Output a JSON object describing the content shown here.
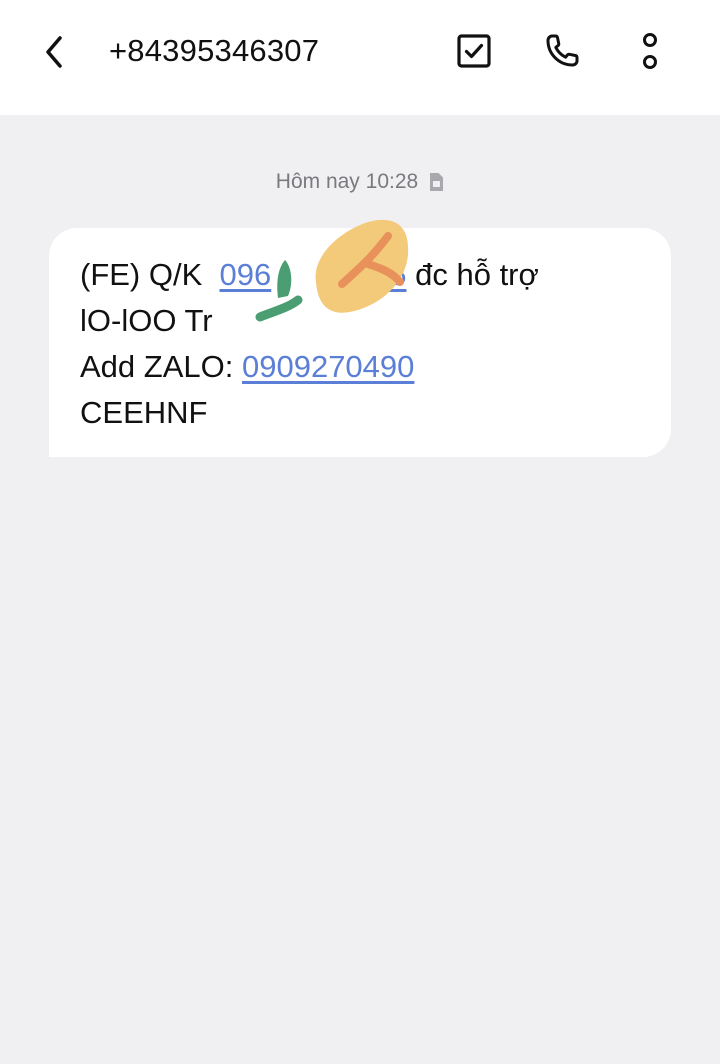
{
  "header": {
    "contact": "+84395346307",
    "icons": {
      "back": "chevron-left-icon",
      "select": "checkbox-icon",
      "call": "phone-icon",
      "more": "more-vertical-icon"
    }
  },
  "conversation": {
    "timestamp": "Hôm nay 10:28",
    "sim_icon": "sim-card-icon",
    "message": {
      "line1_prefix": "(FE) Q/K",
      "line1_link_visible": "096",
      "line1_link_tail": "5",
      "line1_suffix": "đc hỗ trợ",
      "line2": "lO-lOO Tr",
      "line3_prefix": "Add ZALO:",
      "line3_link": "0909270490",
      "line4": "CEEHNF"
    }
  },
  "colors": {
    "background": "#f0f0f3",
    "bubble": "#ffffff",
    "link": "#5b7fd6",
    "text": "#111111",
    "muted": "#7a7a7e",
    "scribble_green": "#4a9e72",
    "scribble_yellow": "#f3c97a",
    "scribble_orange": "#e8915b"
  }
}
